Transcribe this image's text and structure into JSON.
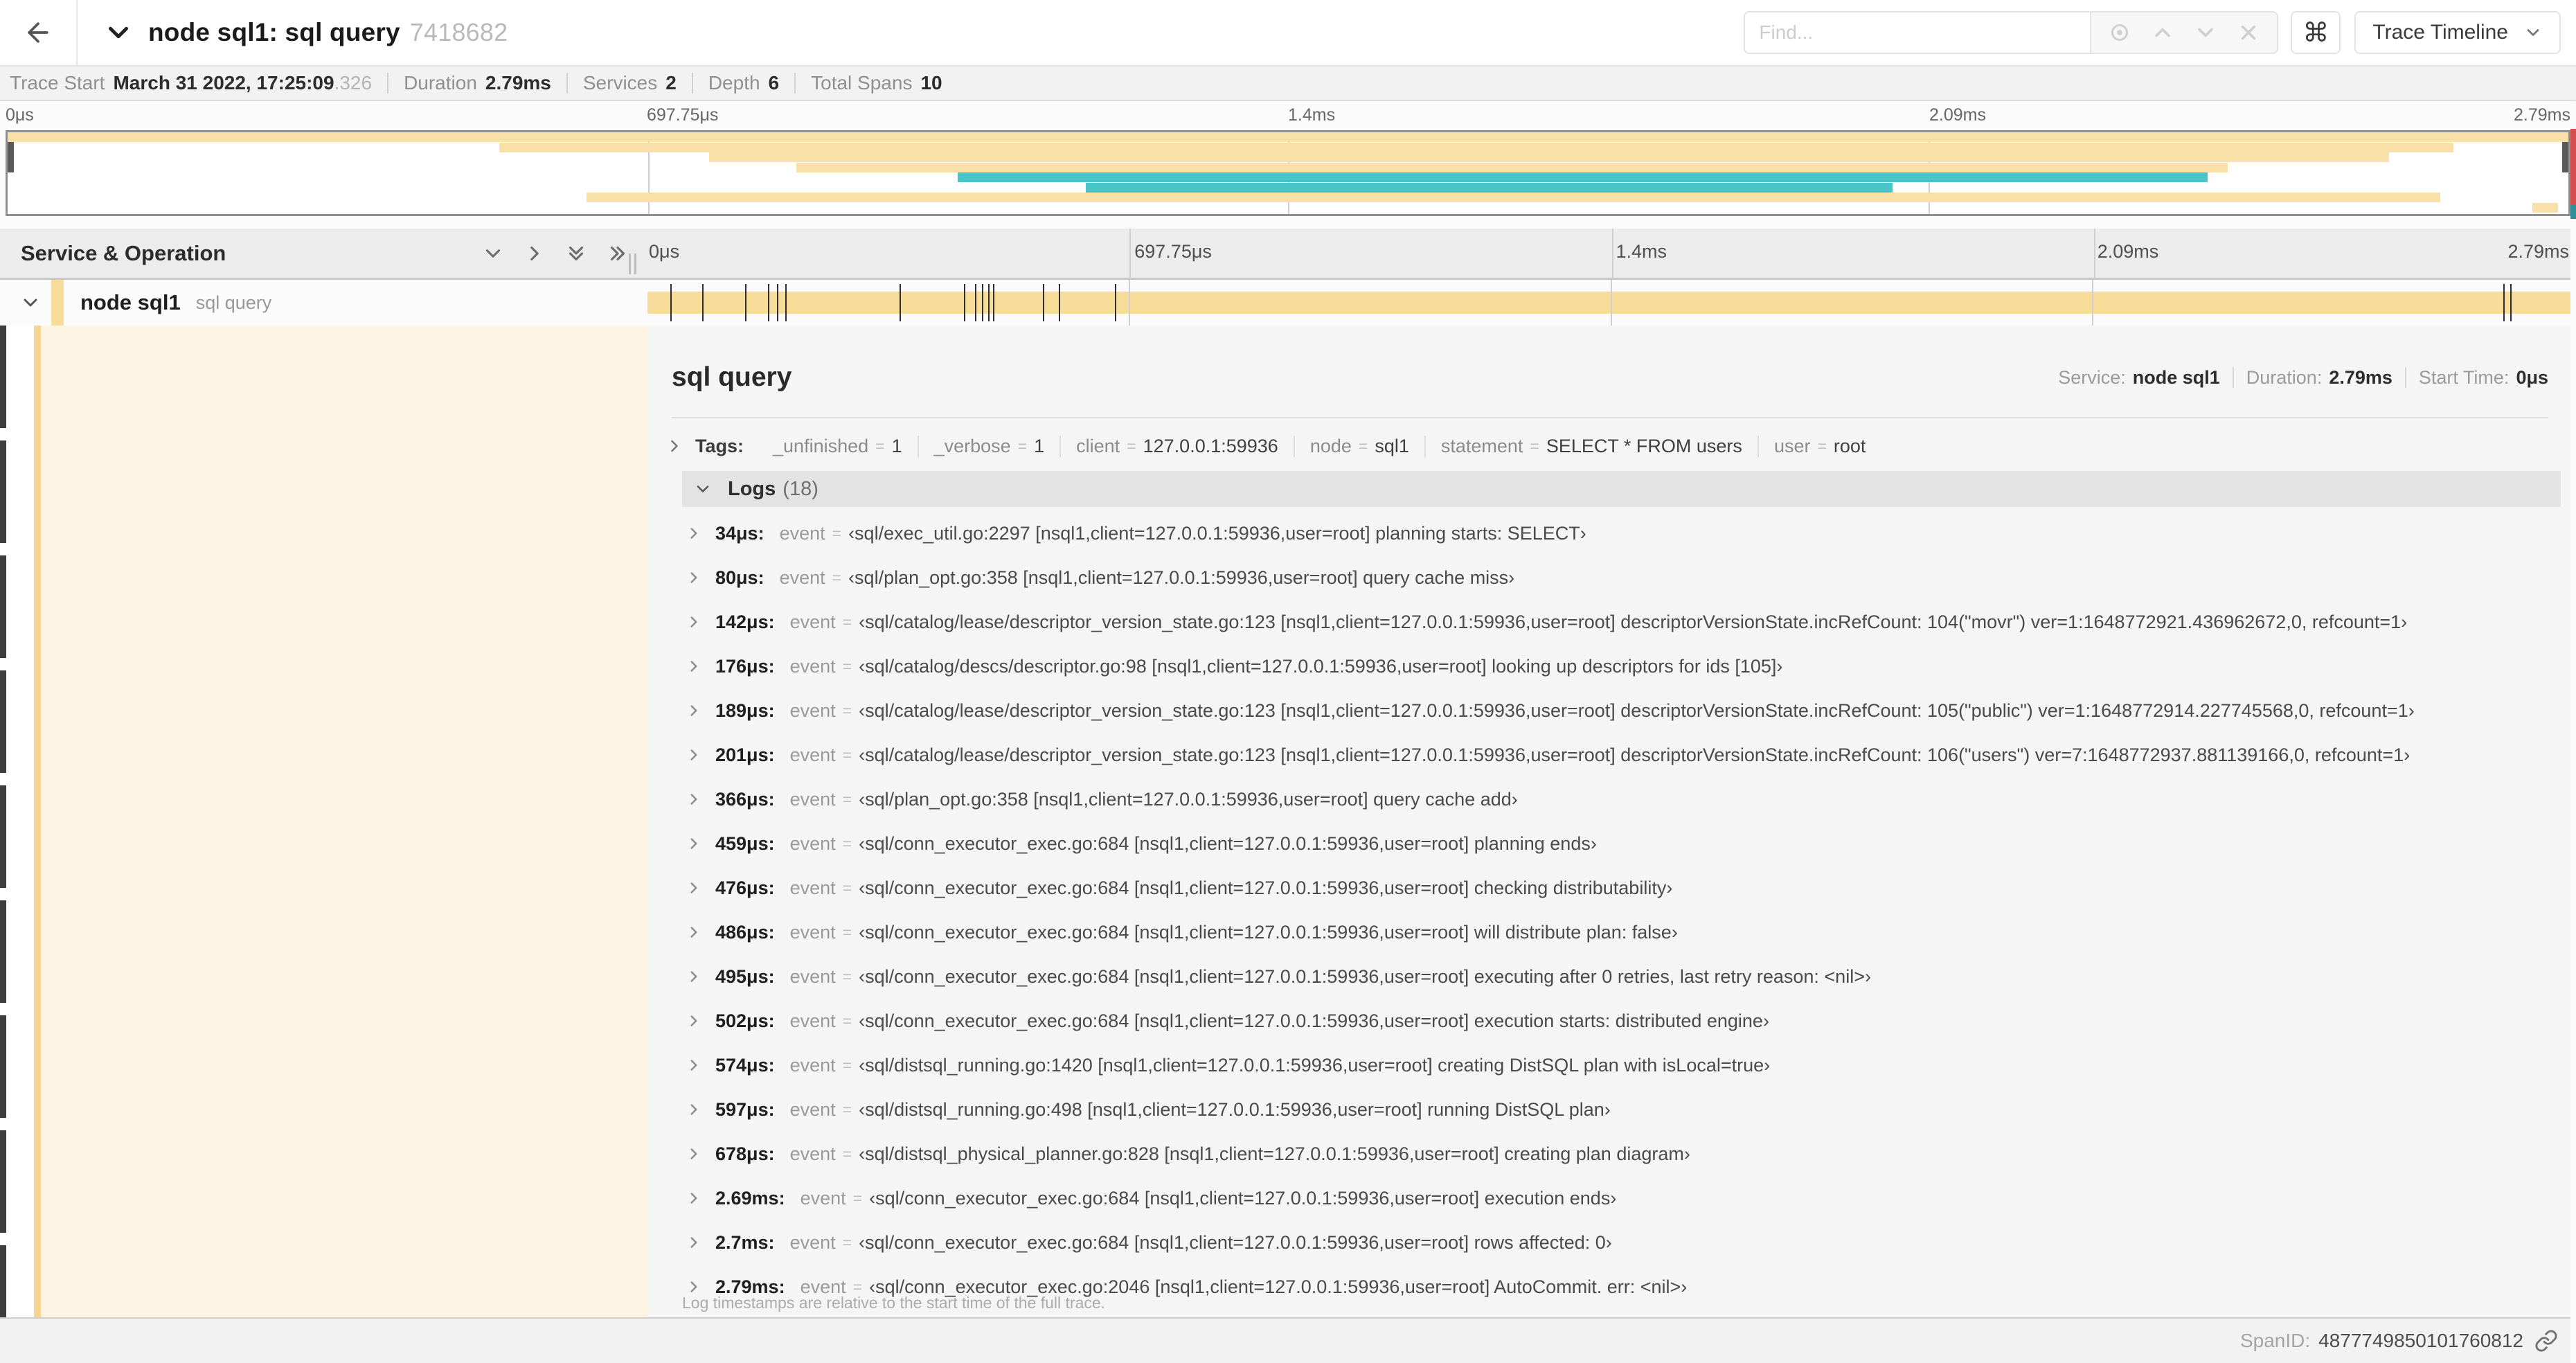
{
  "colors": {
    "tan": "#f8e0a8",
    "teal": "#48c5c9",
    "bar_tan": "#f8dc99"
  },
  "header": {
    "title": "node sql1: sql query",
    "trace_id": "7418682",
    "find_placeholder": "Find...",
    "view_dropdown_label": "Trace Timeline",
    "kbd_glyph": "⌘"
  },
  "summary": {
    "items": [
      {
        "label": "Trace Start",
        "value": "March 31 2022, 17:25:09",
        "suffix": ".326"
      },
      {
        "label": "Duration",
        "value": "2.79ms",
        "suffix": ""
      },
      {
        "label": "Services",
        "value": "2",
        "suffix": ""
      },
      {
        "label": "Depth",
        "value": "6",
        "suffix": ""
      },
      {
        "label": "Total Spans",
        "value": "10",
        "suffix": ""
      }
    ]
  },
  "minimap": {
    "ticks": [
      "0μs",
      "697.75μs",
      "1.4ms",
      "2.09ms",
      "2.79ms"
    ],
    "tick_fracs": [
      0,
      0.25,
      0.5,
      0.75,
      1
    ],
    "spans": [
      {
        "s": 0.0,
        "e": 1.0,
        "c": "tan"
      },
      {
        "s": 0.192,
        "e": 0.955,
        "c": "tan"
      },
      {
        "s": 0.274,
        "e": 0.93,
        "c": "tan"
      },
      {
        "s": 0.308,
        "e": 0.867,
        "c": "tan"
      },
      {
        "s": 0.371,
        "e": 0.859,
        "c": "teal"
      },
      {
        "s": 0.421,
        "e": 0.736,
        "c": "teal"
      },
      {
        "s": 0.226,
        "e": 0.95,
        "c": "tan"
      },
      {
        "s": 0.986,
        "e": 0.996,
        "c": "tan"
      }
    ]
  },
  "timeline": {
    "left_header": "Service & Operation",
    "axis_ticks": [
      "0μs",
      "697.75μs",
      "1.4ms",
      "2.09ms",
      "2.79ms"
    ],
    "axis_fracs": [
      0,
      0.25,
      0.5,
      0.75,
      1
    ],
    "duration_us": 2790
  },
  "span_row": {
    "service": "node sql1",
    "operation": "sql query"
  },
  "detail": {
    "title": "sql query",
    "meta": [
      {
        "label": "Service:",
        "value": "node sql1"
      },
      {
        "label": "Duration:",
        "value": "2.79ms"
      },
      {
        "label": "Start Time:",
        "value": "0μs"
      }
    ],
    "tags_label": "Tags:",
    "tags": [
      {
        "key": "_unfinished",
        "value": "1"
      },
      {
        "key": "_verbose",
        "value": "1"
      },
      {
        "key": "client",
        "value": "127.0.0.1:59936"
      },
      {
        "key": "node",
        "value": "sql1"
      },
      {
        "key": "statement",
        "value": "SELECT * FROM users"
      },
      {
        "key": "user",
        "value": "root"
      }
    ],
    "logs_label": "Logs",
    "logs_count": "(18)",
    "log_key": "event",
    "logs": [
      {
        "t": "34μs:",
        "us": 34,
        "text": "‹sql/exec_util.go:2297 [nsql1,client=127.0.0.1:59936,user=root] planning starts: SELECT›"
      },
      {
        "t": "80μs:",
        "us": 80,
        "text": "‹sql/plan_opt.go:358 [nsql1,client=127.0.0.1:59936,user=root] query cache miss›"
      },
      {
        "t": "142μs:",
        "us": 142,
        "text": "‹sql/catalog/lease/descriptor_version_state.go:123 [nsql1,client=127.0.0.1:59936,user=root] descriptorVersionState.incRefCount: 104(\"movr\") ver=1:1648772921.436962672,0, refcount=1›"
      },
      {
        "t": "176μs:",
        "us": 176,
        "text": "‹sql/catalog/descs/descriptor.go:98 [nsql1,client=127.0.0.1:59936,user=root] looking up descriptors for ids [105]›"
      },
      {
        "t": "189μs:",
        "us": 189,
        "text": "‹sql/catalog/lease/descriptor_version_state.go:123 [nsql1,client=127.0.0.1:59936,user=root] descriptorVersionState.incRefCount: 105(\"public\") ver=1:1648772914.227745568,0, refcount=1›"
      },
      {
        "t": "201μs:",
        "us": 201,
        "text": "‹sql/catalog/lease/descriptor_version_state.go:123 [nsql1,client=127.0.0.1:59936,user=root] descriptorVersionState.incRefCount: 106(\"users\") ver=7:1648772937.881139166,0, refcount=1›"
      },
      {
        "t": "366μs:",
        "us": 366,
        "text": "‹sql/plan_opt.go:358 [nsql1,client=127.0.0.1:59936,user=root] query cache add›"
      },
      {
        "t": "459μs:",
        "us": 459,
        "text": "‹sql/conn_executor_exec.go:684 [nsql1,client=127.0.0.1:59936,user=root] planning ends›"
      },
      {
        "t": "476μs:",
        "us": 476,
        "text": "‹sql/conn_executor_exec.go:684 [nsql1,client=127.0.0.1:59936,user=root] checking distributability›"
      },
      {
        "t": "486μs:",
        "us": 486,
        "text": "‹sql/conn_executor_exec.go:684 [nsql1,client=127.0.0.1:59936,user=root] will distribute plan: false›"
      },
      {
        "t": "495μs:",
        "us": 495,
        "text": "‹sql/conn_executor_exec.go:684 [nsql1,client=127.0.0.1:59936,user=root] executing after 0 retries, last retry reason: <nil>›"
      },
      {
        "t": "502μs:",
        "us": 502,
        "text": "‹sql/conn_executor_exec.go:684 [nsql1,client=127.0.0.1:59936,user=root] execution starts: distributed engine›"
      },
      {
        "t": "574μs:",
        "us": 574,
        "text": "‹sql/distsql_running.go:1420 [nsql1,client=127.0.0.1:59936,user=root] creating DistSQL plan with isLocal=true›"
      },
      {
        "t": "597μs:",
        "us": 597,
        "text": "‹sql/distsql_running.go:498 [nsql1,client=127.0.0.1:59936,user=root] running DistSQL plan›"
      },
      {
        "t": "678μs:",
        "us": 678,
        "text": "‹sql/distsql_physical_planner.go:828 [nsql1,client=127.0.0.1:59936,user=root] creating plan diagram›"
      },
      {
        "t": "2.69ms:",
        "us": 2690,
        "text": "‹sql/conn_executor_exec.go:684 [nsql1,client=127.0.0.1:59936,user=root] execution ends›"
      },
      {
        "t": "2.7ms:",
        "us": 2700,
        "text": "‹sql/conn_executor_exec.go:684 [nsql1,client=127.0.0.1:59936,user=root] rows affected: 0›"
      },
      {
        "t": "2.79ms:",
        "us": 2790,
        "text": "‹sql/conn_executor_exec.go:2046 [nsql1,client=127.0.0.1:59936,user=root] AutoCommit. err: <nil>›"
      }
    ],
    "footnote": "Log timestamps are relative to the start time of the full trace.",
    "spanid_label": "SpanID:",
    "spanid_value": "4877749850101760812"
  }
}
